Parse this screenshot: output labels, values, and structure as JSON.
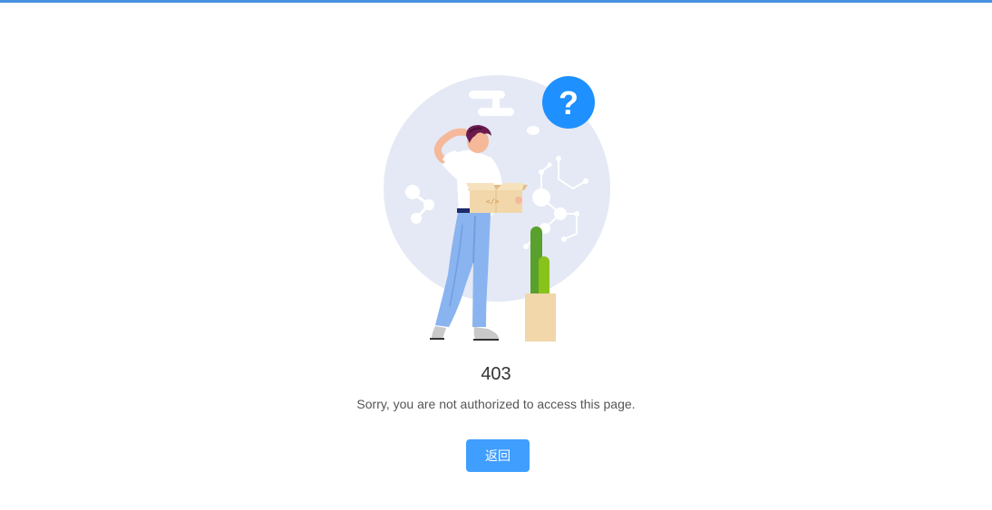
{
  "colors": {
    "accent": "#409eff",
    "top_bar": "#4a90e2",
    "background": "#ffffff"
  },
  "illustration": {
    "question_mark": "?"
  },
  "error": {
    "code": "403",
    "message": "Sorry, you are not authorized to access this page."
  },
  "actions": {
    "back_label": "返回"
  }
}
